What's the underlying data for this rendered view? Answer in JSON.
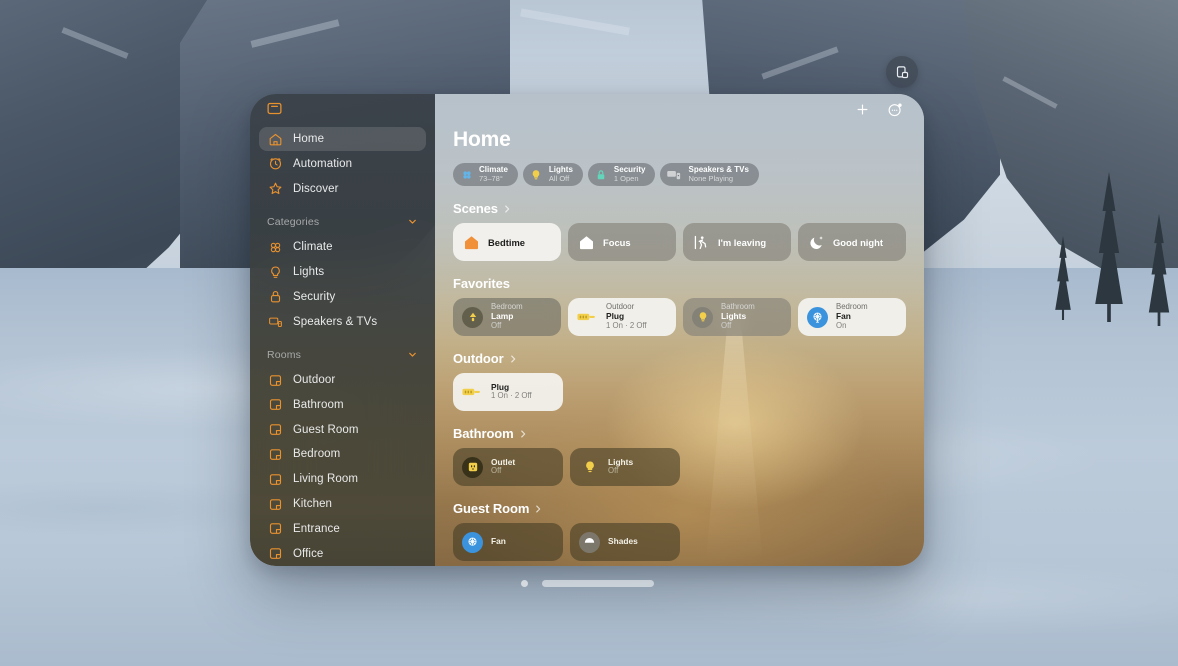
{
  "window": {
    "app_icon": "home-app-icon",
    "float_button_icon": "share-window-icon",
    "add_button_icon": "plus-icon",
    "more_button_icon": "more-circle-icon",
    "page_dot": "page-indicator-dot",
    "resize_grip": "window-resize-grip"
  },
  "sidebar": {
    "nav": [
      {
        "label": "Home",
        "icon": "house-icon",
        "active": true
      },
      {
        "label": "Automation",
        "icon": "clock-icon",
        "active": false
      },
      {
        "label": "Discover",
        "icon": "star-icon",
        "active": false
      }
    ],
    "categories_header": "Categories",
    "categories": [
      {
        "label": "Climate",
        "icon": "fan-icon"
      },
      {
        "label": "Lights",
        "icon": "bulb-icon"
      },
      {
        "label": "Security",
        "icon": "lock-icon"
      },
      {
        "label": "Speakers & TVs",
        "icon": "tv-icon"
      }
    ],
    "rooms_header": "Rooms",
    "rooms": [
      {
        "label": "Outdoor",
        "icon": "room-icon"
      },
      {
        "label": "Bathroom",
        "icon": "room-icon"
      },
      {
        "label": "Guest Room",
        "icon": "room-icon"
      },
      {
        "label": "Bedroom",
        "icon": "room-icon"
      },
      {
        "label": "Living Room",
        "icon": "room-icon"
      },
      {
        "label": "Kitchen",
        "icon": "room-icon"
      },
      {
        "label": "Entrance",
        "icon": "room-icon"
      },
      {
        "label": "Office",
        "icon": "room-icon"
      }
    ]
  },
  "main": {
    "title": "Home",
    "status_pills": [
      {
        "title": "Climate",
        "status": "73–78°",
        "icon": "climate-icon",
        "color": "#63b4e8"
      },
      {
        "title": "Lights",
        "status": "All Off",
        "icon": "bulb-icon",
        "color": "#f2cf4a"
      },
      {
        "title": "Security",
        "status": "1 Open",
        "icon": "lock-icon",
        "color": "#62d5bb"
      },
      {
        "title": "Speakers & TVs",
        "status": "None Playing",
        "icon": "tv-icon",
        "color": "#cfd1d3"
      }
    ],
    "sections": [
      {
        "title": "Scenes",
        "chevron": true,
        "kind": "scenes",
        "cards": [
          {
            "label": "Bedtime",
            "icon": "house-icon",
            "selected": true
          },
          {
            "label": "Focus",
            "icon": "house-icon",
            "selected": false
          },
          {
            "label": "I'm leaving",
            "icon": "walking-icon",
            "selected": false
          },
          {
            "label": "Good night",
            "icon": "moon-icon",
            "selected": false
          }
        ]
      },
      {
        "title": "Favorites",
        "chevron": false,
        "kind": "accessories",
        "cards": [
          {
            "room": "Bedroom",
            "name": "Lamp",
            "status": "Off",
            "icon": "lamp-icon",
            "state": "dim",
            "badge": "ic-olive"
          },
          {
            "room": "Outdoor",
            "name": "Plug",
            "status": "1 On · 2 Off",
            "icon": "plug-icon",
            "state": "light-on",
            "badge": "none"
          },
          {
            "room": "Bathroom",
            "name": "Lights",
            "status": "Off",
            "icon": "bulb-icon",
            "state": "gray",
            "badge": "ic-gray"
          },
          {
            "room": "Bedroom",
            "name": "Fan",
            "status": "On",
            "icon": "fan-icon",
            "state": "light-on",
            "badge": "ic-blue"
          }
        ]
      },
      {
        "title": "Outdoor",
        "chevron": true,
        "kind": "accessories",
        "cards": [
          {
            "room": "",
            "name": "Plug",
            "status": "1 On · 2 Off",
            "icon": "plug-icon",
            "state": "light-on",
            "badge": "none"
          }
        ]
      },
      {
        "title": "Bathroom",
        "chevron": true,
        "kind": "accessories",
        "cards": [
          {
            "room": "",
            "name": "Outlet",
            "status": "Off",
            "icon": "outlet-icon",
            "state": "dark",
            "badge": "ic-dark"
          },
          {
            "room": "",
            "name": "Lights",
            "status": "Off",
            "icon": "bulb-icon",
            "state": "dark",
            "badge": "none"
          }
        ]
      },
      {
        "title": "Guest Room",
        "chevron": true,
        "kind": "accessories",
        "cards": [
          {
            "room": "",
            "name": "Fan",
            "status": "",
            "icon": "fan-icon",
            "state": "dark",
            "badge": "ic-blue"
          },
          {
            "room": "",
            "name": "Shades",
            "status": "",
            "icon": "shades-icon",
            "state": "dark",
            "badge": "ic-gray"
          }
        ]
      }
    ]
  },
  "colors": {
    "accent": "#e8912f",
    "sidebar_text": "#e9eaea",
    "active_card": "#f4f3f0"
  }
}
